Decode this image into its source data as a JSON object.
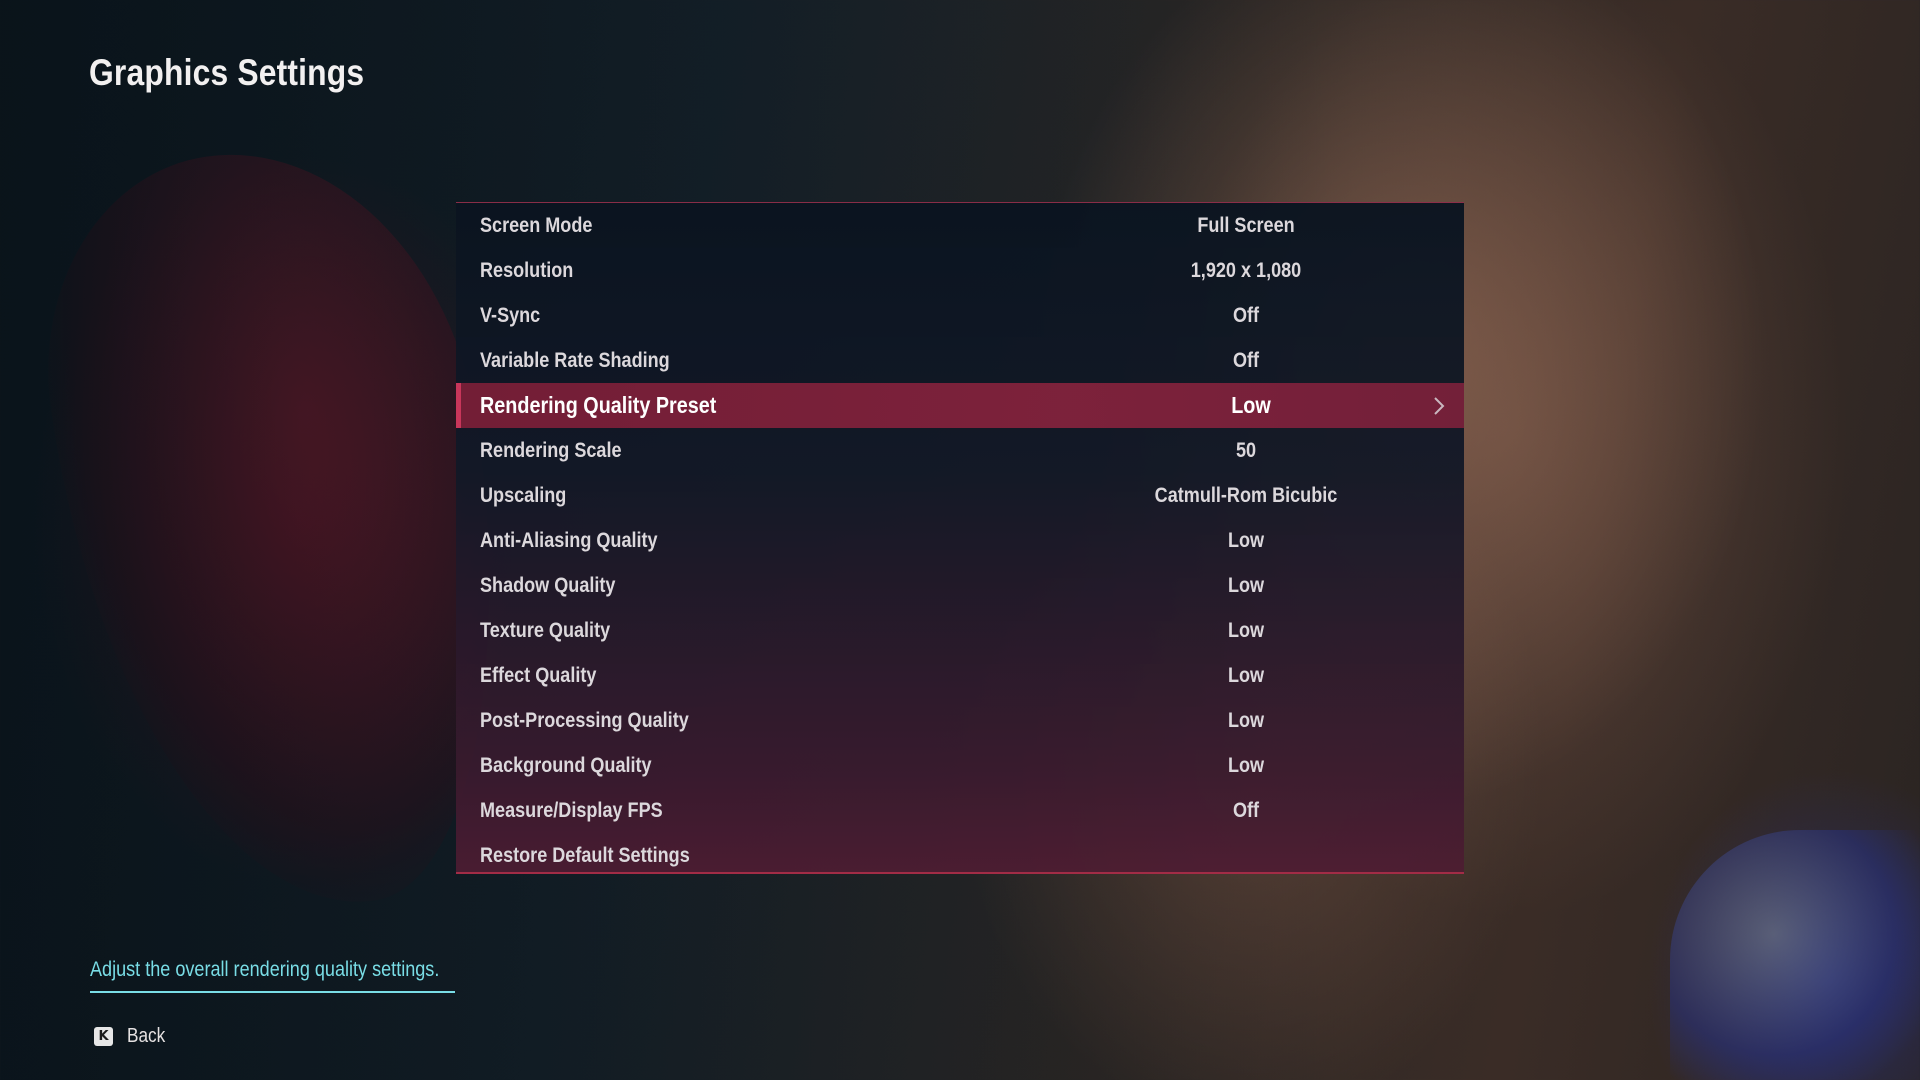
{
  "page": {
    "title": "Graphics Settings"
  },
  "settings": [
    {
      "label": "Screen Mode",
      "value": "Full Screen"
    },
    {
      "label": "Resolution",
      "value": "1,920 x 1,080"
    },
    {
      "label": "V-Sync",
      "value": "Off"
    },
    {
      "label": "Variable Rate Shading",
      "value": "Off"
    },
    {
      "label": "Rendering Quality Preset",
      "value": "Low",
      "selected": true
    },
    {
      "label": "Rendering Scale",
      "value": "50"
    },
    {
      "label": "Upscaling",
      "value": "Catmull-Rom Bicubic"
    },
    {
      "label": "Anti-Aliasing Quality",
      "value": "Low"
    },
    {
      "label": "Shadow Quality",
      "value": "Low"
    },
    {
      "label": "Texture Quality",
      "value": "Low"
    },
    {
      "label": "Effect Quality",
      "value": "Low"
    },
    {
      "label": "Post-Processing Quality",
      "value": "Low"
    },
    {
      "label": "Background Quality",
      "value": "Low"
    },
    {
      "label": "Measure/Display FPS",
      "value": "Off"
    },
    {
      "label": "Restore Default Settings",
      "value": ""
    }
  ],
  "selected_index": 4,
  "hint": {
    "text": "Adjust the overall rendering quality settings."
  },
  "footer": {
    "back_key": "K",
    "back_label": "Back"
  },
  "colors": {
    "selected_row": "#82223c",
    "hint_text": "#79dde6",
    "panel_border": "#c8325a"
  },
  "icons": {
    "selected_row_arrow": "chevron-right-icon",
    "back_key": "keyboard-key-icon"
  }
}
